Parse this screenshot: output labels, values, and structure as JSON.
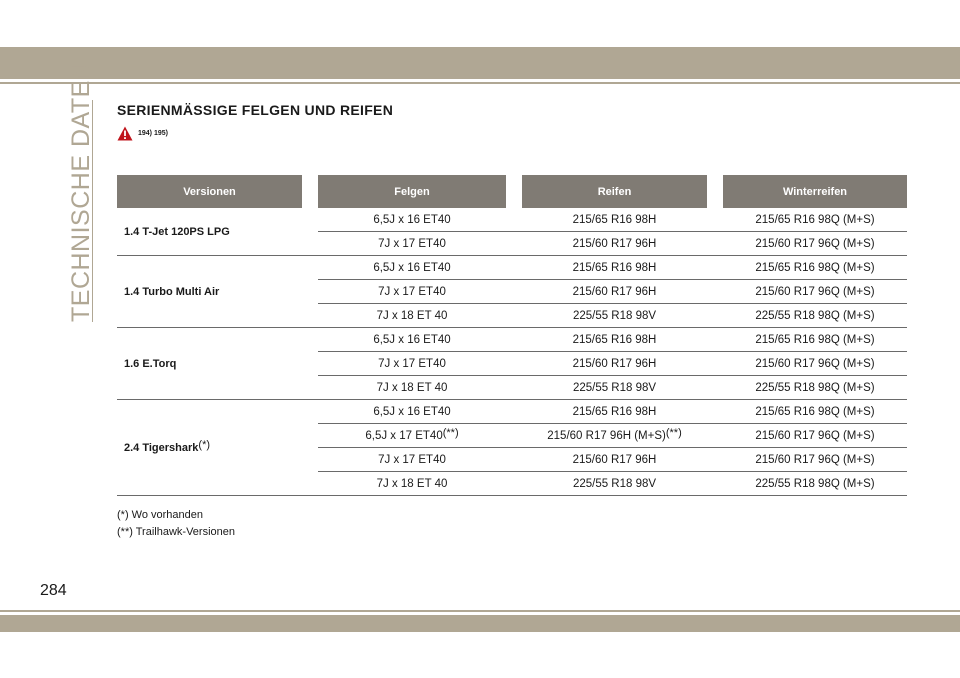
{
  "side_title": "TECHNISCHE DATEN",
  "heading": "SERIENMÄSSIGE FELGEN UND REIFEN",
  "warning_refs": "194) 195)",
  "table": {
    "headers": [
      "Versionen",
      "Felgen",
      "Reifen",
      "Winterreifen"
    ],
    "groups": [
      {
        "version": "1.4 T-Jet 120PS LPG",
        "version_sup": "",
        "rows": [
          {
            "felgen": "6,5J x 16 ET40",
            "felgen_sup": "",
            "reifen": "215/65 R16 98H",
            "reifen_sup": "",
            "winter": "215/65 R16 98Q (M+S)"
          },
          {
            "felgen": "7J x 17 ET40",
            "felgen_sup": "",
            "reifen": "215/60 R17 96H",
            "reifen_sup": "",
            "winter": "215/60 R17 96Q (M+S)"
          }
        ]
      },
      {
        "version": "1.4 Turbo Multi Air",
        "version_sup": "",
        "rows": [
          {
            "felgen": "6,5J x 16 ET40",
            "felgen_sup": "",
            "reifen": "215/65 R16 98H",
            "reifen_sup": "",
            "winter": "215/65 R16 98Q (M+S)"
          },
          {
            "felgen": "7J x 17 ET40",
            "felgen_sup": "",
            "reifen": "215/60 R17 96H",
            "reifen_sup": "",
            "winter": "215/60 R17 96Q (M+S)"
          },
          {
            "felgen": "7J x 18 ET 40",
            "felgen_sup": "",
            "reifen": "225/55 R18 98V",
            "reifen_sup": "",
            "winter": "225/55 R18 98Q (M+S)"
          }
        ]
      },
      {
        "version": "1.6 E.Torq",
        "version_sup": "",
        "rows": [
          {
            "felgen": "6,5J x 16 ET40",
            "felgen_sup": "",
            "reifen": "215/65 R16 98H",
            "reifen_sup": "",
            "winter": "215/65 R16 98Q (M+S)"
          },
          {
            "felgen": "7J x 17 ET40",
            "felgen_sup": "",
            "reifen": "215/60 R17 96H",
            "reifen_sup": "",
            "winter": "215/60 R17 96Q (M+S)"
          },
          {
            "felgen": "7J x 18 ET 40",
            "felgen_sup": "",
            "reifen": "225/55 R18 98V",
            "reifen_sup": "",
            "winter": "225/55 R18 98Q (M+S)"
          }
        ]
      },
      {
        "version": "2.4 Tigershark",
        "version_sup": "(*)",
        "rows": [
          {
            "felgen": "6,5J x 16 ET40",
            "felgen_sup": "",
            "reifen": "215/65 R16 98H",
            "reifen_sup": "",
            "winter": "215/65 R16 98Q (M+S)"
          },
          {
            "felgen": "6,5J x 17 ET40",
            "felgen_sup": "(**)",
            "reifen": "215/60 R17 96H (M+S)",
            "reifen_sup": "(**)",
            "winter": "215/60 R17 96Q (M+S)"
          },
          {
            "felgen": "7J x 17 ET40",
            "felgen_sup": "",
            "reifen": "215/60 R17 96H",
            "reifen_sup": "",
            "winter": "215/60 R17 96Q (M+S)"
          },
          {
            "felgen": "7J x 18 ET 40",
            "felgen_sup": "",
            "reifen": "225/55 R18 98V",
            "reifen_sup": "",
            "winter": "225/55 R18 98Q (M+S)"
          }
        ]
      }
    ]
  },
  "footnotes": [
    "(*) Wo vorhanden",
    "(**) Trailhawk-Versionen"
  ],
  "page_number": "284",
  "colors": {
    "accent": "#b0a794",
    "header_bg": "#807b74",
    "warning_red": "#c0141c"
  }
}
